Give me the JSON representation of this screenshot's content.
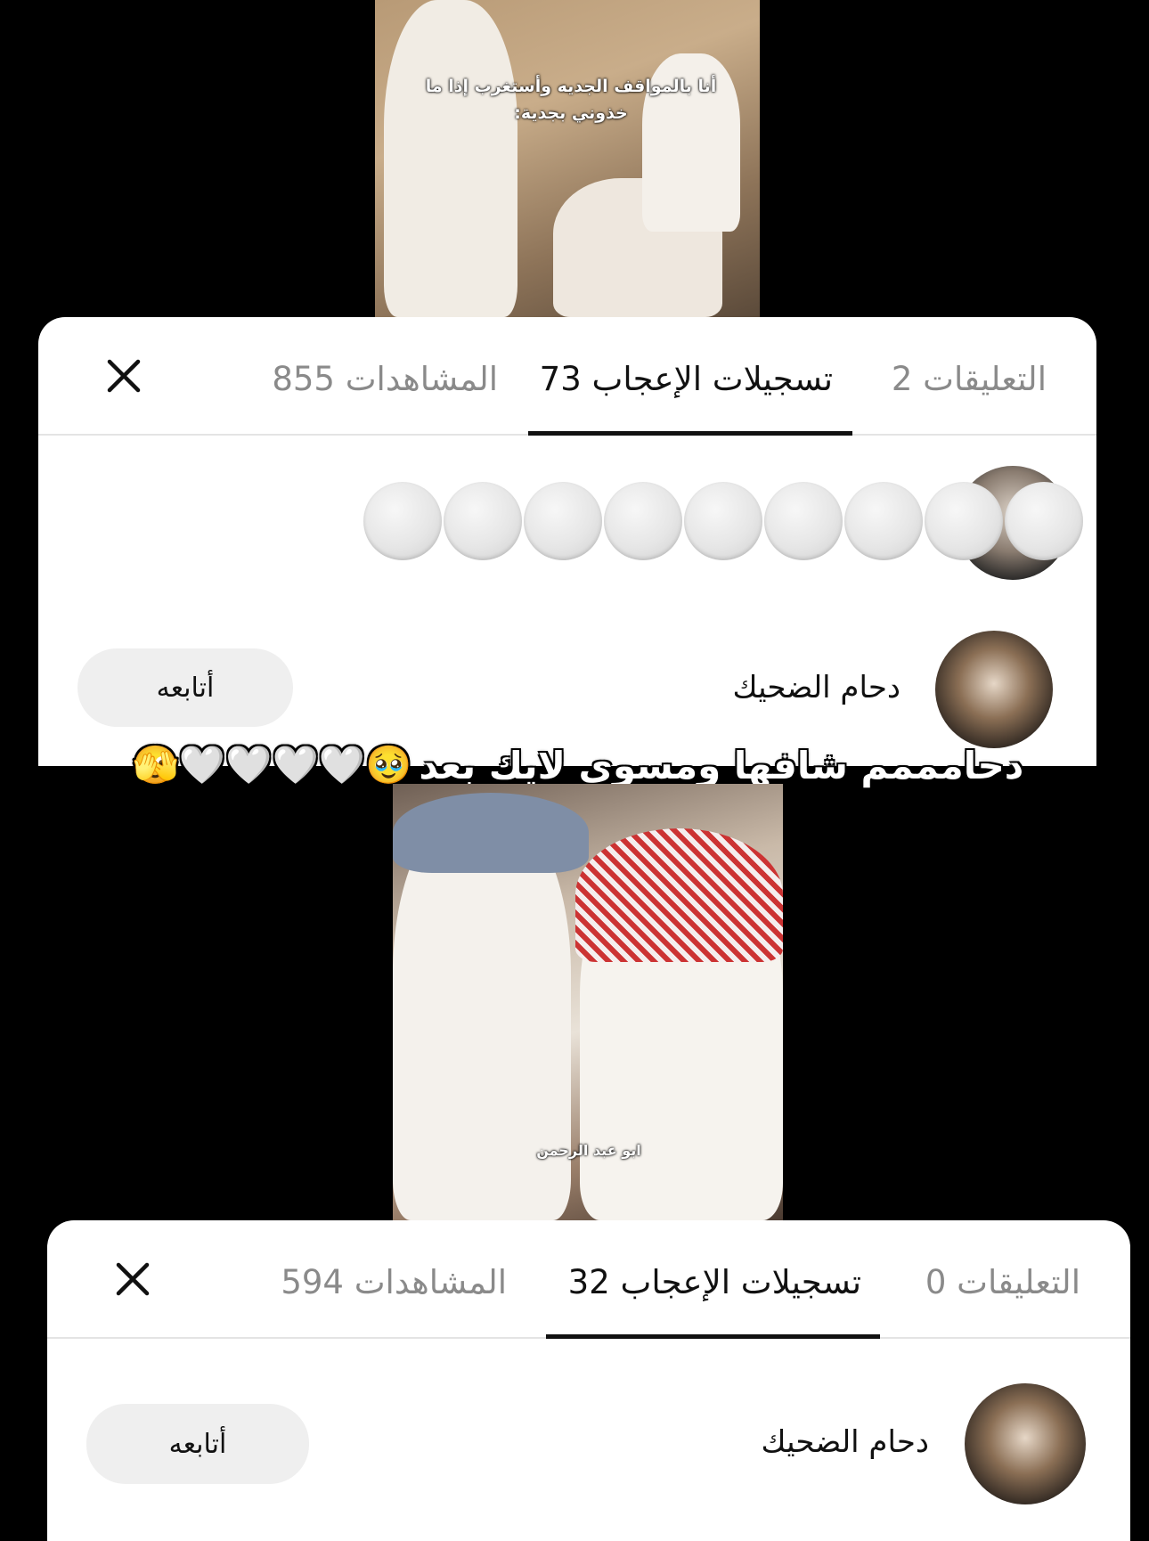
{
  "video1": {
    "caption": "أنا بالمواقف الجديه وأستغرب إذا ما خذوني بجدية:"
  },
  "sheet1": {
    "tabs": [
      {
        "label": "التعليقات 2",
        "active": false
      },
      {
        "label": "تسجيلات الإعجاب 73",
        "active": true
      },
      {
        "label": "المشاهدات 855",
        "active": false
      }
    ],
    "close_icon": "close-icon",
    "user": {
      "name": "دحام الضحيك",
      "follow_label": "أتابعه"
    }
  },
  "overlay": {
    "text": "دحامممم شافها ومسوي لايك بعد",
    "emojis": "🥹🤍🤍🤍🤍🫣"
  },
  "video2": {
    "caption": "ابو عبد الرحمن"
  },
  "sheet2": {
    "tabs": [
      {
        "label": "التعليقات 0",
        "active": false
      },
      {
        "label": "تسجيلات الإعجاب 32",
        "active": true
      },
      {
        "label": "المشاهدات 594",
        "active": false
      }
    ],
    "close_icon": "close-icon",
    "user": {
      "name": "دحام الضحيك",
      "follow_label": "أتابعه"
    }
  },
  "colors": {
    "background": "#000000",
    "sheet": "#ffffff",
    "inactive_tab": "#8a8a8a",
    "active_tab": "#111111",
    "follow_button": "#efefef"
  }
}
